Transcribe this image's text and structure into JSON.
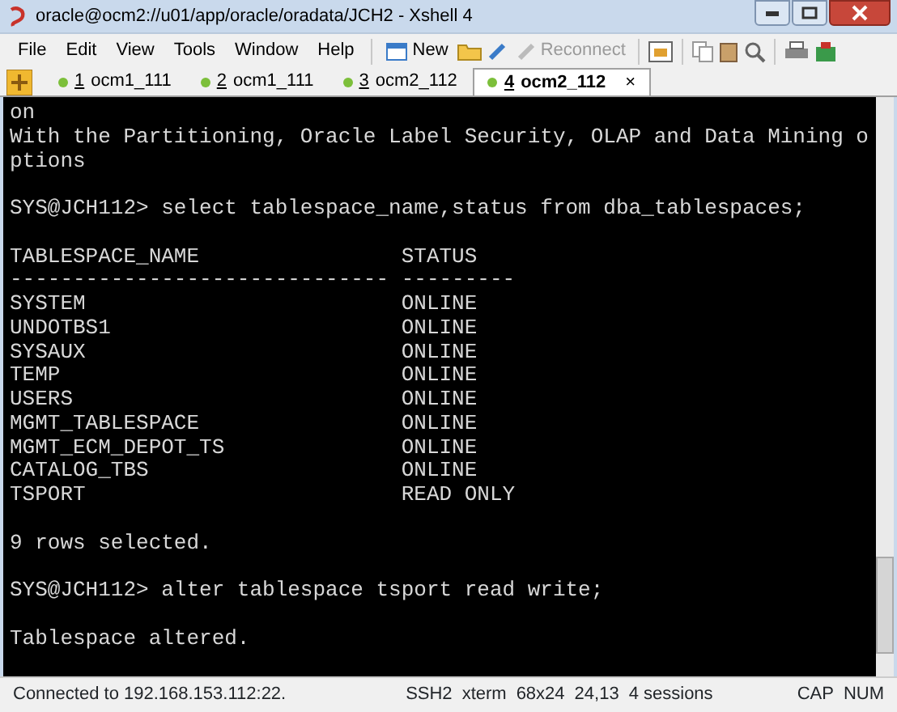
{
  "window": {
    "title": "oracle@ocm2://u01/app/oracle/oradata/JCH2 - Xshell 4"
  },
  "menu": [
    "File",
    "Edit",
    "View",
    "Tools",
    "Window",
    "Help"
  ],
  "toolbar": [
    {
      "kind": "labeled",
      "label": "New",
      "disabled": false
    },
    {
      "kind": "labeled",
      "label": "Reconnect",
      "disabled": true
    }
  ],
  "tabs": [
    {
      "number": "1",
      "label": " ocm1_111",
      "selected": false
    },
    {
      "number": "2",
      "label": " ocm1_111",
      "selected": false
    },
    {
      "number": "3",
      "label": " ocm2_112",
      "selected": false
    },
    {
      "number": "4",
      "label": " ocm2_112",
      "selected": true,
      "close": "×"
    }
  ],
  "terminal": {
    "blocks": [
      [
        "on",
        "With the Partitioning, Oracle Label Security, OLAP and Data Mining o",
        "ptions"
      ],
      [
        "SYS@JCH112> select tablespace_name,status from dba_tablespaces;"
      ],
      [
        "TABLESPACE_NAME                STATUS",
        "------------------------------ ---------",
        "SYSTEM                         ONLINE",
        "UNDOTBS1                       ONLINE",
        "SYSAUX                         ONLINE",
        "TEMP                           ONLINE",
        "USERS                          ONLINE",
        "MGMT_TABLESPACE                ONLINE",
        "MGMT_ECM_DEPOT_TS              ONLINE",
        "CATALOG_TBS                    ONLINE",
        "TSPORT                         READ ONLY"
      ],
      [
        "9 rows selected."
      ],
      [
        "SYS@JCH112> alter tablespace tsport read write;"
      ],
      [
        "Tablespace altered."
      ]
    ]
  },
  "status_bar": {
    "message": "Connected to 192.168.153.112:22.",
    "fields": [
      "SSH2",
      "xterm",
      "68x24",
      "24,13",
      "4 sessions"
    ],
    "keys": [
      "CAP",
      "NUM"
    ]
  }
}
